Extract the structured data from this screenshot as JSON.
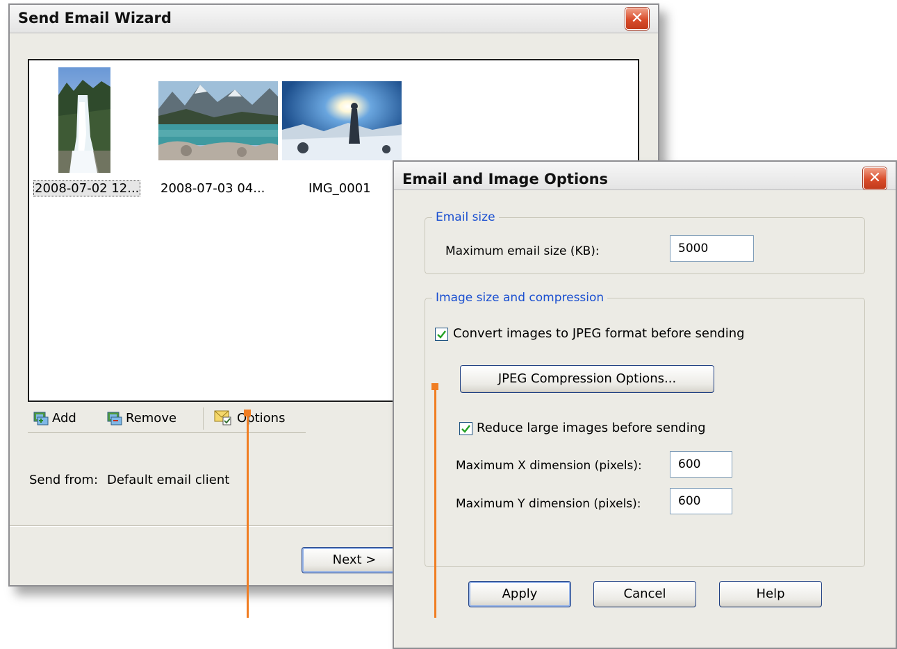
{
  "wizard": {
    "title": "Send Email Wizard",
    "thumbnails": [
      {
        "caption": "2008-07-02 12...",
        "icon": "waterfall-photo"
      },
      {
        "caption": "2008-07-03 04...",
        "icon": "mountain-lake-photo"
      },
      {
        "caption": "IMG_0001",
        "icon": "sunset-hiker-photo"
      }
    ],
    "toolbar": {
      "add_label": "Add",
      "remove_label": "Remove",
      "options_label": "Options"
    },
    "send_from_label": "Send from:",
    "send_from_value": "Default email client",
    "next_label": "Next >"
  },
  "options_dialog": {
    "title": "Email and Image Options",
    "email_size_group": "Email size",
    "max_email_label": "Maximum email size (KB):",
    "max_email_value": "5000",
    "image_group": "Image size and compression",
    "convert_label": "Convert images to JPEG format before sending",
    "convert_checked": true,
    "jpeg_button_label": "JPEG Compression Options...",
    "reduce_label": "Reduce large images before sending",
    "reduce_checked": true,
    "max_x_label": "Maximum X dimension (pixels):",
    "max_x_value": "600",
    "max_y_label": "Maximum Y dimension (pixels):",
    "max_y_value": "600",
    "apply_label": "Apply",
    "cancel_label": "Cancel",
    "help_label": "Help"
  },
  "colors": {
    "callout": "#f07d22",
    "group_title": "#1a4fd0",
    "close_button": "#d94c2a"
  }
}
